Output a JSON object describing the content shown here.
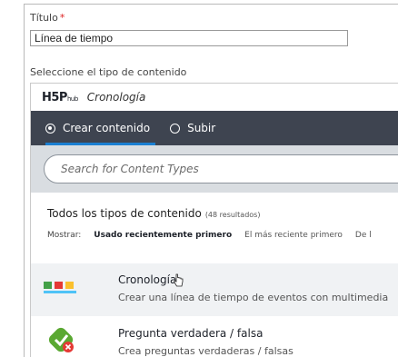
{
  "form": {
    "title_label": "Título",
    "required_mark": "*",
    "title_value": "Línea de tiempo",
    "content_type_label": "Seleccione el tipo de contenido"
  },
  "hub": {
    "logo": "H5P",
    "logo_suffix": "hub",
    "selected_name": "Cronología",
    "tabs": [
      {
        "label": "Crear contenido",
        "active": true
      },
      {
        "label": "Subir",
        "active": false
      }
    ],
    "search_placeholder": "Search for Content Types",
    "list_title": "Todos los tipos de contenido",
    "result_count": "(48 resultados)",
    "sort_label": "Mostrar:",
    "sort_options": [
      "Usado recientemente primero",
      "El más reciente primero",
      "De l"
    ],
    "items": [
      {
        "name": "Cronología",
        "description": "Crear una línea de tiempo de eventos con multimedia",
        "icon": "timeline-icon"
      },
      {
        "name": "Pregunta verdadera / falsa",
        "description": "Crea preguntas verdaderas / falsas",
        "icon": "true-false-icon"
      }
    ]
  },
  "colors": {
    "tabs_bg": "#3e4450",
    "search_bg": "#d9dde1",
    "accent": "#1a7fd1",
    "required": "#dd2222"
  }
}
